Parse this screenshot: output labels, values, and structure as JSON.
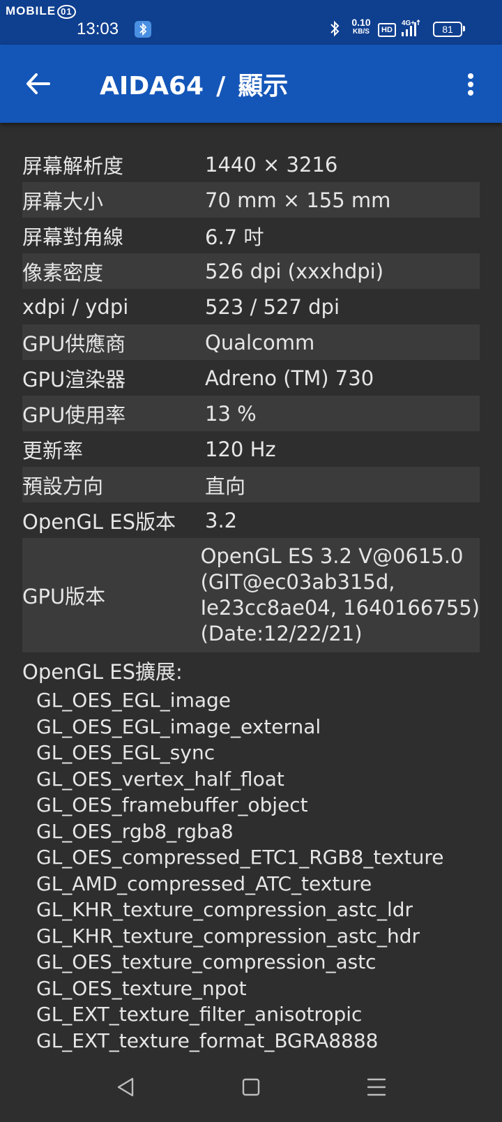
{
  "status_bar": {
    "watermark": "MOBILE",
    "watermark_badge": "01",
    "time": "13:03",
    "net_speed_value": "0.10",
    "net_speed_unit": "KB/S",
    "hd": "HD",
    "network_type": "4G+",
    "battery": "81",
    "icons": [
      "bluetooth-app-icon",
      "bluetooth-icon",
      "signal-icon",
      "battery-icon"
    ]
  },
  "app_bar": {
    "app_name": "AIDA64",
    "separator": "/",
    "page_title": "顯示",
    "icons": [
      "back-arrow-icon",
      "more-vert-icon"
    ]
  },
  "rows": [
    {
      "label": "屏幕解析度",
      "value": "1440 × 3216"
    },
    {
      "label": "屏幕大小",
      "value": "70 mm × 155 mm"
    },
    {
      "label": "屏幕對角線",
      "value": "6.7 吋"
    },
    {
      "label": "像素密度",
      "value": "526 dpi (xxxhdpi)"
    },
    {
      "label": "xdpi / ydpi",
      "value": "523 / 527 dpi"
    },
    {
      "label": "GPU供應商",
      "value": "Qualcomm"
    },
    {
      "label": "GPU渲染器",
      "value": "Adreno (TM) 730"
    },
    {
      "label": "GPU使用率",
      "value": "13 %"
    },
    {
      "label": "更新率",
      "value": "120 Hz"
    },
    {
      "label": "預設方向",
      "value": "直向"
    },
    {
      "label": "OpenGL ES版本",
      "value": "3.2"
    }
  ],
  "gpu_version": {
    "label": "GPU版本",
    "lines": [
      "OpenGL ES 3.2 V@0615.0",
      "(GIT@ec03ab315d,",
      "Ie23cc8ae04, 1640166755)",
      "(Date:12/22/21)"
    ]
  },
  "extensions": {
    "header": "OpenGL ES擴展:",
    "items": [
      "GL_OES_EGL_image",
      "GL_OES_EGL_image_external",
      "GL_OES_EGL_sync",
      "GL_OES_vertex_half_float",
      "GL_OES_framebuffer_object",
      "GL_OES_rgb8_rgba8",
      "GL_OES_compressed_ETC1_RGB8_texture",
      "GL_AMD_compressed_ATC_texture",
      "GL_KHR_texture_compression_astc_ldr",
      "GL_KHR_texture_compression_astc_hdr",
      "GL_OES_texture_compression_astc",
      "GL_OES_texture_npot",
      "GL_EXT_texture_filter_anisotropic",
      "GL_EXT_texture_format_BGRA8888"
    ]
  },
  "nav_bar": {
    "icons": [
      "nav-back-icon",
      "nav-home-icon",
      "nav-recents-icon"
    ]
  },
  "colors": {
    "status_bar": "#0f3f8f",
    "app_bar": "#1456b8",
    "background": "#2e2e2e",
    "row_alt": "#3b3b3b",
    "text": "#e6e6e6"
  }
}
